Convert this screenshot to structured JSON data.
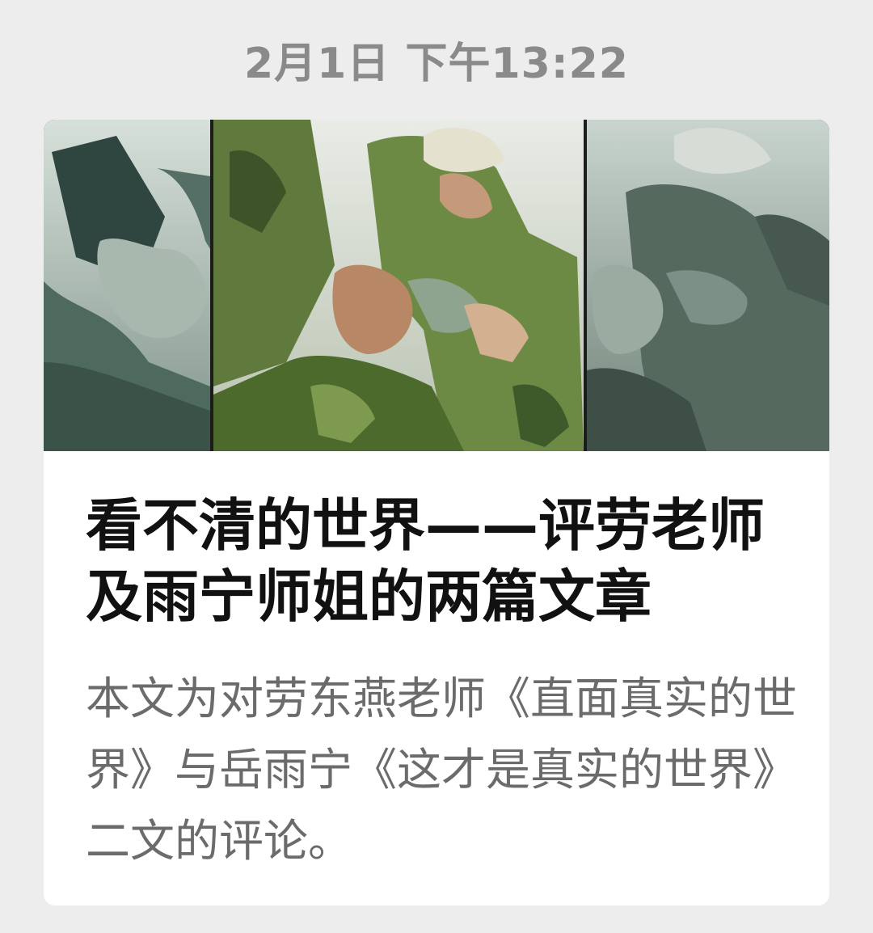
{
  "timestamp": "2月1日 下午13:22",
  "article": {
    "title": "看不清的世界——评劳老师及雨宁师姐的两篇文章",
    "digest": "本文为对劳东燕老师《直面真实的世界》与岳雨宁《这才是真实的世界》二文的评论。"
  },
  "colors": {
    "background": "#ededed",
    "card": "#ffffff",
    "title": "#111111",
    "digest": "#6b6b6b",
    "timestamp": "#8a8a8a"
  }
}
